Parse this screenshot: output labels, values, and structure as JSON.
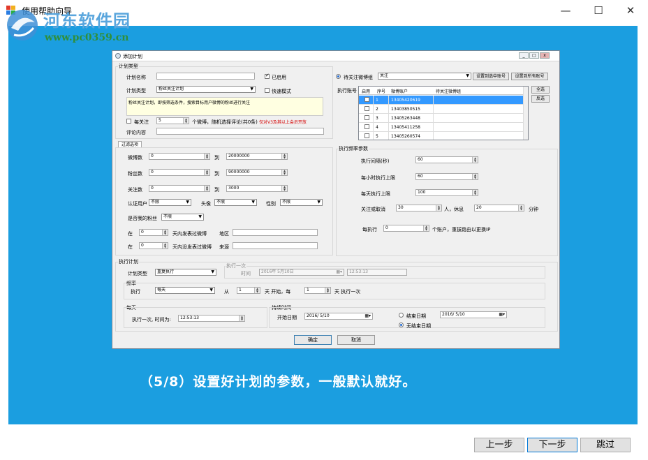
{
  "window": {
    "title": "使用帮助向导",
    "minimize_icon": "minimize-icon",
    "maximize_icon": "maximize-icon",
    "close_icon": "close-icon"
  },
  "watermark": {
    "site_name": "河东软件园",
    "url": "www.pc0359.cn"
  },
  "caption": "（5/8）设置好计划的参数，一般默认就好。",
  "nav": {
    "prev": "上一步",
    "next": "下一步",
    "skip": "跳过"
  },
  "dialog": {
    "title": "添加计划",
    "plan_group": "计划类型",
    "plan_name_label": "计划名称",
    "enabled_label": "已启用",
    "plan_type_label": "计划类型",
    "plan_type_value": "粉丝关注计划",
    "fast_mode_label": "快速模式",
    "description": "粉丝关注计划，即按筛选条件，搜索目标用户微博的粉丝进行关注",
    "per_follow_label": "每关注",
    "per_follow_value": "5",
    "per_follow_suffix": "个微博，随机选择评论(共0条)",
    "vip_note": "仅对V3及其以上会员开放",
    "comment_label": "评论内容",
    "filter_tab": "过滤选项",
    "weibo_count_label": "微博数",
    "weibo_min": "0",
    "to1": "到",
    "weibo_max": "20000000",
    "fans_label": "粉丝数",
    "fans_min": "0",
    "to2": "到",
    "fans_max": "90000000",
    "follow_label": "关注数",
    "follow_min": "0",
    "to3": "到",
    "follow_max": "3000",
    "verified_label": "认证用户",
    "verified_value": "不限",
    "avatar_label": "头像",
    "avatar_value": "不限",
    "gender_label": "性别",
    "gender_value": "不限",
    "is_my_fan_label": "是否我的粉丝",
    "is_my_fan_value": "不限",
    "in1_label": "在",
    "in1_value": "0",
    "posted_label": "天内发表过微博",
    "region_label": "地区",
    "in2_label": "在",
    "in2_value": "0",
    "not_posted_label": "天内没发表过微博",
    "source_label": "来源",
    "target_radio": "待关注微博组",
    "target_value": "关注",
    "set_selected_btn": "设置到选中账号",
    "set_all_btn": "设置到所有账号",
    "exec_account_label": "执行账号",
    "select_all_btn": "全选",
    "invert_btn": "反选",
    "grid_headers": [
      "启用",
      "序号",
      "微博账户",
      "待关注微博组"
    ],
    "grid_rows": [
      {
        "no": "1",
        "account": "13405420619",
        "group": ""
      },
      {
        "no": "2",
        "account": "13403850515",
        "group": ""
      },
      {
        "no": "3",
        "account": "13405263448",
        "group": ""
      },
      {
        "no": "4",
        "account": "13405411258",
        "group": ""
      },
      {
        "no": "5",
        "account": "13405260574",
        "group": ""
      }
    ],
    "freq_group": "执行频率参数",
    "interval_label": "执行间隔(秒)",
    "interval_value": "60",
    "hourly_limit_label": "每小时执行上限",
    "hourly_limit_value": "60",
    "daily_limit_label": "每天执行上限",
    "daily_limit_value": "100",
    "follow_cancel_label": "关注或取消",
    "follow_cancel_value": "30",
    "rest_label": "人，休息",
    "rest_value": "20",
    "minutes_label": "分钟",
    "per_exec_label": "每执行",
    "per_exec_value": "0",
    "reroute_label": "个账户，重拔路由以更换IP",
    "schedule_group": "执行计划",
    "sched_type_label": "计划类型",
    "sched_type_value": "重复执行",
    "once_group": "执行一次",
    "time_label": "时间",
    "once_date": "2016年 5月10日",
    "once_time": "12:53:13",
    "freq_sub": "频率",
    "exec_label": "执行",
    "exec_value": "每天",
    "from_label": "从",
    "from_value": "1",
    "day_start_label": "天 开始，每",
    "every_value": "1",
    "day_once_label": "天 执行一次",
    "daily_sub": "每天",
    "once_at_label": "执行一次, 时间为:",
    "once_at_value": "12:53:13",
    "duration_sub": "持续时间",
    "start_date_label": "开始日期",
    "start_date_value": "2016/ 5/10",
    "end_date_label": "结束日期",
    "end_date_value": "2016/ 5/10",
    "no_end_label": "无结束日期",
    "ok_btn": "确定",
    "cancel_btn": "取消"
  },
  "colors": {
    "blue_panel": "#1b9ee0",
    "selection": "#3399ff",
    "red_note": "#d40000"
  }
}
